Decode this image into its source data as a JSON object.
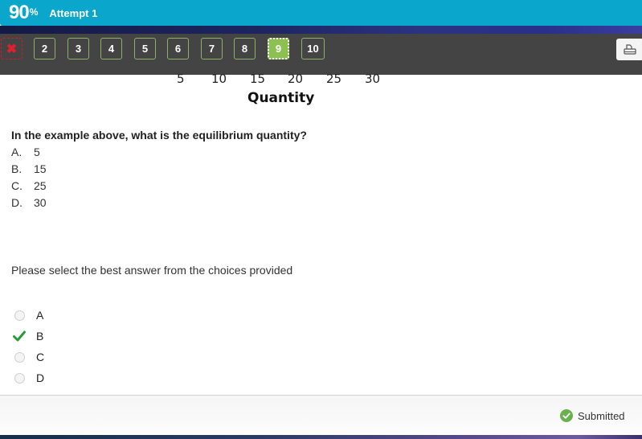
{
  "header": {
    "score": "90",
    "score_unit": "%",
    "attempt_label": "Attempt 1"
  },
  "question_nav": {
    "items": [
      {
        "label": "✖",
        "state": "incorrect",
        "icon": "x-icon"
      },
      {
        "label": "2",
        "state": "answered"
      },
      {
        "label": "3",
        "state": "answered"
      },
      {
        "label": "4",
        "state": "answered"
      },
      {
        "label": "5",
        "state": "answered"
      },
      {
        "label": "6",
        "state": "answered"
      },
      {
        "label": "7",
        "state": "answered"
      },
      {
        "label": "8",
        "state": "answered"
      },
      {
        "label": "9",
        "state": "current"
      },
      {
        "label": "10",
        "state": "answered"
      }
    ],
    "print_icon": "printer-icon"
  },
  "figure": {
    "x_ticks": [
      "5",
      "10",
      "15",
      "20",
      "25",
      "30"
    ],
    "x_label": "Quantity"
  },
  "question": {
    "text": "In the example above, what is the equilibrium quantity?",
    "choices": [
      {
        "letter": "A.",
        "value": "5"
      },
      {
        "letter": "B.",
        "value": "15"
      },
      {
        "letter": "C.",
        "value": "25"
      },
      {
        "letter": "D.",
        "value": "30"
      }
    ]
  },
  "instruction": "Please select the best answer from the choices provided",
  "answers": [
    {
      "label": "A",
      "selected": false
    },
    {
      "label": "B",
      "selected": true
    },
    {
      "label": "C",
      "selected": false
    },
    {
      "label": "D",
      "selected": false
    }
  ],
  "footer": {
    "status": "Submitted"
  },
  "colors": {
    "header_bg": "#0aa6cb",
    "nav_bg": "#444444",
    "current_question": "#8cc152",
    "incorrect": "#d01c2a",
    "check_green": "#2a9a3a",
    "submitted_green": "#6ab04c"
  }
}
